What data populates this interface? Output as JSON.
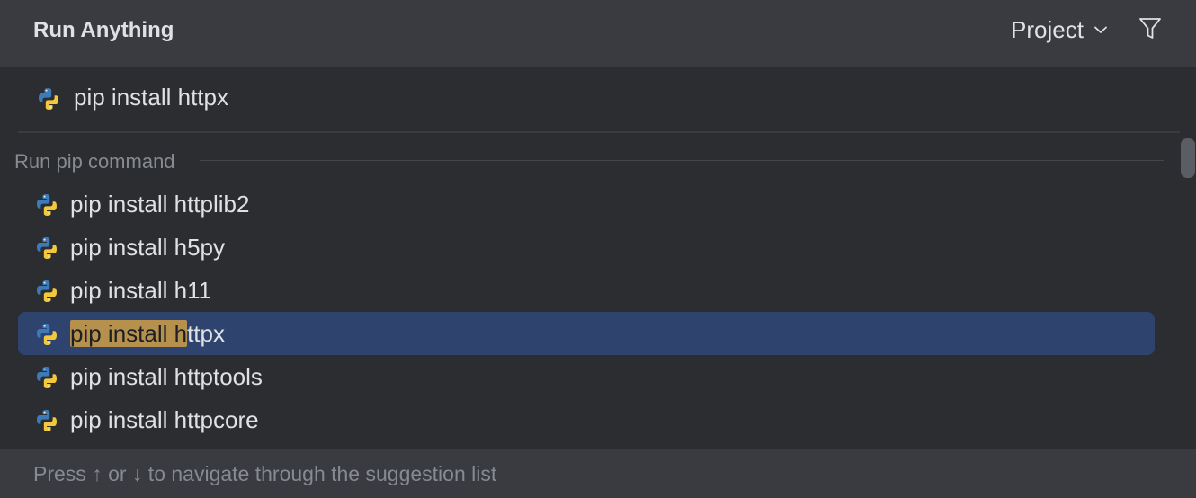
{
  "header": {
    "title": "Run Anything",
    "scope_label": "Project",
    "scope_icon": "chevron-down-icon",
    "filter_icon": "filter-icon"
  },
  "input": {
    "value": "pip install httpx",
    "icon": "python-icon"
  },
  "section": {
    "label": "Run pip command"
  },
  "suggestions": [
    {
      "label": "pip install httplib2",
      "icon": "python-icon"
    },
    {
      "label": "pip install h5py",
      "icon": "python-icon"
    },
    {
      "label": "pip install h11",
      "icon": "python-icon"
    },
    {
      "label": "pip install httpx",
      "match": "pip install h",
      "rest": "ttpx",
      "selected": true,
      "icon": "python-icon"
    },
    {
      "label": "pip install httptools",
      "icon": "python-icon"
    },
    {
      "label": "pip install httpcore",
      "icon": "python-icon"
    }
  ],
  "footer": {
    "hint": "Press ↑ or ↓ to navigate through the suggestion list"
  },
  "colors": {
    "header_bg": "#393b40",
    "body_bg": "#2b2d30",
    "selection_bg": "#2e436e",
    "match_highlight": "#b5914d",
    "python_blue": "#3d7ab8",
    "python_yellow": "#f2c83c"
  }
}
